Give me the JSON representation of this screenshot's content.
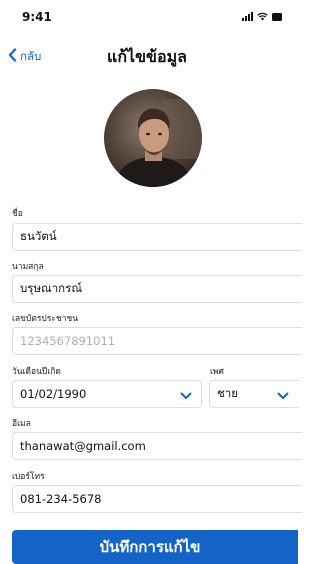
{
  "status_bar": {
    "time": "9:41"
  },
  "nav": {
    "back_label": "กลับ",
    "title": "แก้ไขข้อมูล"
  },
  "form": {
    "first_name": {
      "label": "ชื่อ",
      "value": "ธนวัตน์"
    },
    "last_name": {
      "label": "นามสกุล",
      "value": "บรุษณากรณ์"
    },
    "id_card": {
      "label": "เลขบัตรประชาชน",
      "placeholder": "1234567891011"
    },
    "birth_date": {
      "label": "วันเดือนปีเกิด",
      "value": "01/02/1990"
    },
    "gender": {
      "label": "เพศ",
      "value": "ชาย"
    },
    "email": {
      "label": "อีเมล",
      "value": "thanawat@gmail.com"
    },
    "phone": {
      "label": "เบอร์โทร",
      "value": "081-234-5678"
    }
  },
  "save_button": {
    "label": "บันทึกการแก้ไข"
  },
  "colors": {
    "accent": "#1464c8",
    "link": "#1a66d6"
  }
}
